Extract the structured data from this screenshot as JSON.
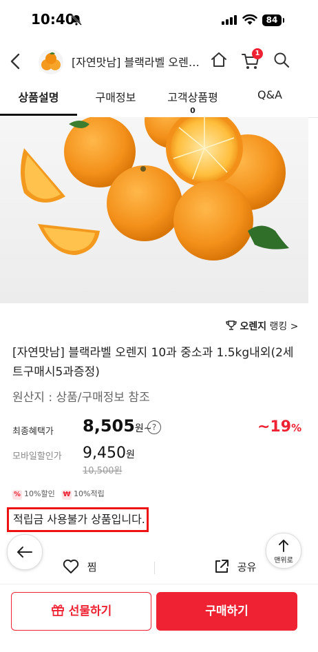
{
  "status_bar": {
    "time": "10:40",
    "battery": "84"
  },
  "header": {
    "title": "[자연맛남] 블랙라벨 오렌…",
    "cart_count": "1"
  },
  "tabs": [
    {
      "label": "상품설명",
      "count": ""
    },
    {
      "label": "구매정보",
      "count": ""
    },
    {
      "label": "고객상품평",
      "count": "0"
    },
    {
      "label": "Q&A",
      "count": ""
    }
  ],
  "product": {
    "ranking_strong": "오렌지",
    "ranking_suffix": "랭킹 >",
    "title": "[자연맛남] 블랙라벨 오렌지 10과 중소과 1.5kg내외(2세트구매시5과증정)",
    "origin": "원산지 : 상품/구매정보 참조",
    "final_label": "최종혜택가",
    "final_price": "8,505",
    "final_unit": "원~",
    "discount_value": "~19",
    "discount_unit": "%",
    "mobile_label": "모바일할인가",
    "mobile_price": "9,450",
    "mobile_unit": "원",
    "original_price": "10,500원",
    "badge_discount": "10%할인",
    "badge_points": "10%적립",
    "notice": "적립금 사용불가 상품입니다."
  },
  "floating": {
    "top_label": "맨위로"
  },
  "actions": {
    "wish": "찜",
    "share": "공유",
    "gift": "선물하기",
    "buy": "구매하기"
  },
  "colors": {
    "accent": "#ee2233",
    "orange": "#f39a1e"
  }
}
